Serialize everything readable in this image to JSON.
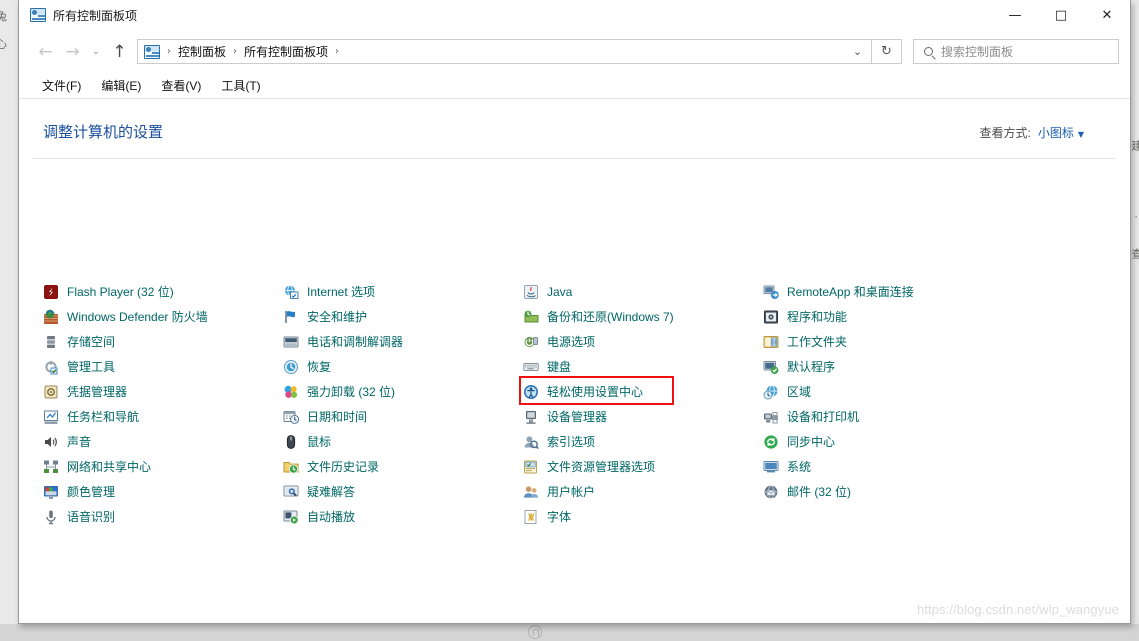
{
  "window": {
    "title": "所有控制面板项",
    "title_icon": "control-panel-icon",
    "minimize_label": "—",
    "maximize_label": "□",
    "close_label": "✕"
  },
  "navbar": {
    "back_label": "←",
    "forward_label": "→",
    "recent_label": "⌄",
    "up_label": "↑",
    "breadcrumbs": [
      "控制面板",
      "所有控制面板项"
    ],
    "separator": "›",
    "dropdown_label": "⌄",
    "refresh_label": "↻"
  },
  "search": {
    "placeholder": "搜索控制面板",
    "icon": "search-icon"
  },
  "menubar": {
    "items": [
      "文件(F)",
      "编辑(E)",
      "查看(V)",
      "工具(T)"
    ]
  },
  "content": {
    "page_title": "调整计算机的设置",
    "view_by_label": "查看方式:",
    "view_by_value": "小图标",
    "view_by_caret": "▼"
  },
  "columns": [
    {
      "items": [
        {
          "label": "Flash Player (32 位)",
          "icon": "flash-player-icon"
        },
        {
          "label": "Windows Defender 防火墙",
          "icon": "firewall-icon"
        },
        {
          "label": "存储空间",
          "icon": "storage-spaces-icon"
        },
        {
          "label": "管理工具",
          "icon": "administrative-tools-icon"
        },
        {
          "label": "凭据管理器",
          "icon": "credential-manager-icon"
        },
        {
          "label": "任务栏和导航",
          "icon": "taskbar-navigation-icon"
        },
        {
          "label": "声音",
          "icon": "sound-icon"
        },
        {
          "label": "网络和共享中心",
          "icon": "network-sharing-icon"
        },
        {
          "label": "颜色管理",
          "icon": "color-management-icon"
        },
        {
          "label": "语音识别",
          "icon": "speech-recognition-icon"
        }
      ]
    },
    {
      "items": [
        {
          "label": "Internet 选项",
          "icon": "internet-options-icon"
        },
        {
          "label": "安全和维护",
          "icon": "security-maintenance-icon"
        },
        {
          "label": "电话和调制解调器",
          "icon": "phone-modem-icon"
        },
        {
          "label": "恢复",
          "icon": "recovery-icon"
        },
        {
          "label": "强力卸载 (32 位)",
          "icon": "force-uninstall-icon"
        },
        {
          "label": "日期和时间",
          "icon": "date-time-icon"
        },
        {
          "label": "鼠标",
          "icon": "mouse-icon"
        },
        {
          "label": "文件历史记录",
          "icon": "file-history-icon"
        },
        {
          "label": "疑难解答",
          "icon": "troubleshooting-icon"
        },
        {
          "label": "自动播放",
          "icon": "autoplay-icon"
        }
      ]
    },
    {
      "items": [
        {
          "label": "Java",
          "icon": "java-icon"
        },
        {
          "label": "备份和还原(Windows 7)",
          "icon": "backup-restore-icon"
        },
        {
          "label": "电源选项",
          "icon": "power-options-icon"
        },
        {
          "label": "键盘",
          "icon": "keyboard-icon"
        },
        {
          "label": "轻松使用设置中心",
          "icon": "ease-of-access-icon",
          "highlighted": true
        },
        {
          "label": "设备管理器",
          "icon": "device-manager-icon"
        },
        {
          "label": "索引选项",
          "icon": "indexing-options-icon"
        },
        {
          "label": "文件资源管理器选项",
          "icon": "file-explorer-options-icon"
        },
        {
          "label": "用户帐户",
          "icon": "user-accounts-icon"
        },
        {
          "label": "字体",
          "icon": "fonts-icon"
        }
      ]
    },
    {
      "items": [
        {
          "label": "RemoteApp 和桌面连接",
          "icon": "remoteapp-icon"
        },
        {
          "label": "程序和功能",
          "icon": "programs-features-icon"
        },
        {
          "label": "工作文件夹",
          "icon": "work-folders-icon"
        },
        {
          "label": "默认程序",
          "icon": "default-programs-icon"
        },
        {
          "label": "区域",
          "icon": "region-icon"
        },
        {
          "label": "设备和打印机",
          "icon": "devices-printers-icon"
        },
        {
          "label": "同步中心",
          "icon": "sync-center-icon"
        },
        {
          "label": "系统",
          "icon": "system-icon"
        },
        {
          "label": "邮件 (32 位)",
          "icon": "mail-icon"
        }
      ]
    }
  ],
  "watermark": "https://blog.csdn.net/wlp_wangyue",
  "desktop": {
    "left_fragments": [
      "兔",
      "心"
    ],
    "right_fragments": [
      "建",
      "·",
      "查"
    ]
  }
}
